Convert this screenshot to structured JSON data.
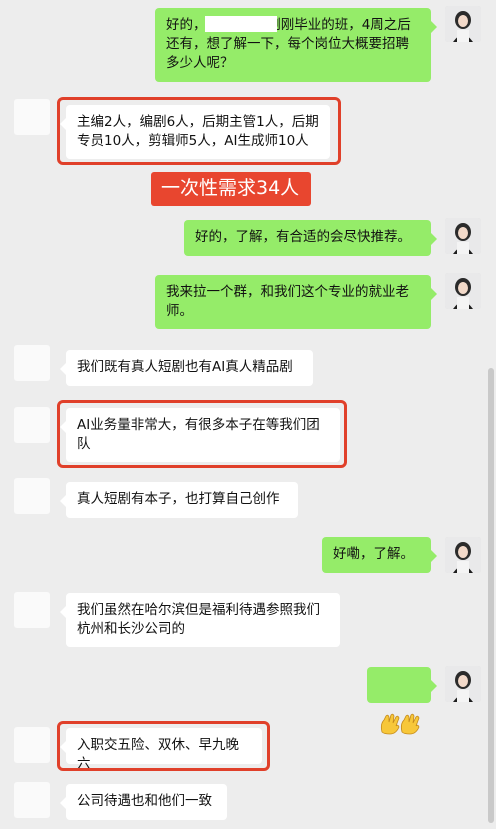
{
  "messages": [
    {
      "id": "m1",
      "side": "right",
      "text": "好的，           有刚刚毕业的班，4周之后还有，想了解一下，每个岗位大概要招聘多少人呢？"
    },
    {
      "id": "m2",
      "side": "left",
      "text": "主编2人，编剧6人，后期主管1人，后期专员10人，剪辑师5人，AI生成师10人",
      "highlighted": true
    },
    {
      "id": "m3",
      "side": "right",
      "text": "好的，了解，有合适的会尽快推荐。"
    },
    {
      "id": "m4",
      "side": "right",
      "text": "我来拉一个群，和我们这个专业的就业老师。"
    },
    {
      "id": "m5",
      "side": "left",
      "text": "我们既有真人短剧也有AI真人精品剧"
    },
    {
      "id": "m6",
      "side": "left",
      "text": "AI业务量非常大，有很多本子在等我们团队",
      "highlighted": true
    },
    {
      "id": "m7",
      "side": "left",
      "text": "真人短剧有本子，也打算自己创作"
    },
    {
      "id": "m8",
      "side": "right",
      "text": "好嘞，了解。"
    },
    {
      "id": "m9",
      "side": "left",
      "text": "我们虽然在哈尔滨但是福利待遇参照我们杭州和长沙公司的"
    },
    {
      "id": "m10",
      "side": "right",
      "text": "👋👋",
      "emoji": "waving-hands"
    },
    {
      "id": "m11",
      "side": "left",
      "text": "入职交五险、双休、早九晚六",
      "highlighted": true
    },
    {
      "id": "m12",
      "side": "left",
      "text": "公司待遇也和他们一致"
    }
  ],
  "annotation": {
    "text": "一次性需求34人",
    "color": "#e8462f"
  },
  "colors": {
    "green_bubble": "#95ec69",
    "white_bubble": "#ffffff",
    "highlight": "#e0402a",
    "background": "#ededed"
  }
}
